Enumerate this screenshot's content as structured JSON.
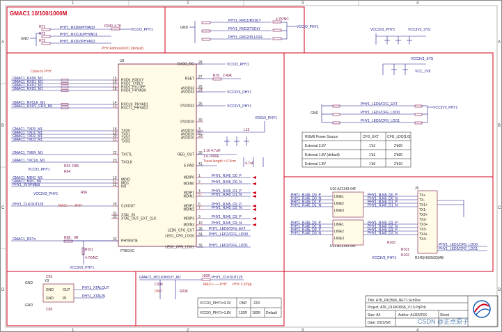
{
  "grid": {
    "columns": [
      "1",
      "2",
      "3",
      "4"
    ],
    "rows": [
      "A",
      "B",
      "C",
      "D"
    ]
  },
  "sections": {
    "title": "GMAC1 10/100/1000M",
    "phy_address": "PHY Address0x01 (default)",
    "close_to_phy": "Close to PHY",
    "mac_phy": "MAC<------PHY",
    "mac_phy2": "MAC<------PHY",
    "trace_length": "Trace length < 0.5cm",
    "dnp": "DNP",
    "vcc3v3_sys": "VCC3V3_SYS",
    "vcc1v8": "VCC_1V8"
  },
  "chip": {
    "ref": "U9",
    "part": "YT8531C",
    "left_pins": [
      {
        "name": "RXD0_RXDLY",
        "num": "15"
      },
      {
        "name": "RXD1_TXDLY",
        "num": "16"
      },
      {
        "name": "RXD2_PLLOFF",
        "num": "17"
      },
      {
        "name": "RXD3_PHYAD0",
        "num": "18"
      },
      {
        "name": "RXCLK_PHYAD1",
        "num": "14"
      },
      {
        "name": "RXCTL_PHYAD2",
        "num": "13"
      },
      {
        "name": "TXD0",
        "num": "18"
      },
      {
        "name": "TXD1",
        "num": "19"
      },
      {
        "name": "TXD2",
        "num": "20"
      },
      {
        "name": "TXD3",
        "num": "21"
      },
      {
        "name": "TXCTL",
        "num": "22"
      },
      {
        "name": "TXCLK",
        "num": "23"
      },
      {
        "name": "MDIO",
        "num": "10"
      },
      {
        "name": "MDC",
        "num": "11"
      },
      {
        "name": "INT",
        "num": "12"
      },
      {
        "name": "CLKOUT",
        "num": "29"
      },
      {
        "name": "XTAL_IN",
        "num": "31"
      },
      {
        "name": "XTAL_OUT_EXT_CLK",
        "num": "33"
      },
      {
        "name": "PHYRSTB",
        "num": "32"
      }
    ],
    "right_pins": [
      {
        "name": "DVDD_RG",
        "num": "28"
      },
      {
        "name": "RSET",
        "num": "27"
      },
      {
        "name": "AVDD33",
        "num": "26"
      },
      {
        "name": "AVDD33",
        "num": "24"
      },
      {
        "name": "DVDD33",
        "num": "25"
      },
      {
        "name": "DVDD10",
        "num": "30"
      },
      {
        "name": "AVDD10",
        "num": "3"
      },
      {
        "name": "AVDD10",
        "num": "8"
      },
      {
        "name": "AVDD10",
        "num": "23"
      },
      {
        "name": "REG_OUT",
        "num": "30"
      },
      {
        "name": "E-PAD",
        "num": "41"
      },
      {
        "name": "MDIP0",
        "num": "1"
      },
      {
        "name": "MDIN0",
        "num": "2"
      },
      {
        "name": "MDIP1",
        "num": "4"
      },
      {
        "name": "MDIN1",
        "num": "5"
      },
      {
        "name": "MDIP2",
        "num": "6"
      },
      {
        "name": "MDIN2",
        "num": "7"
      },
      {
        "name": "MDIP3",
        "num": "9"
      },
      {
        "name": "MDIN3",
        "num": "10"
      },
      {
        "name": "LED0_CFG_EXT",
        "num": "36"
      },
      {
        "name": "LED1_CFG_LDO0",
        "num": "34"
      },
      {
        "name": "LED2_CFG_LDO1",
        "num": "35"
      }
    ]
  },
  "left_nets": [
    "GMAC1_RXD0_M1",
    "GMAC1_RXD1_M1",
    "GMAC1_RXD2_M1",
    "GMAC1_RXD3_M1",
    "GMAC1_RXCLK_M1",
    "GMAC1_RXDV_CRS_M1",
    "GMAC1_TXD0_M1",
    "GMAC1_TXD1_M1",
    "GMAC1_TXD2_M1",
    "GMAC1_TXD3_M1",
    "GMAC1_TXEN_M1",
    "GMAC1_TXCLK_M1",
    "GMAC1_MDIO_M1",
    "GMAC1_MDC_M1",
    "PHY1_INT/PMEB",
    "PHY1_CLKOUT125",
    "GMAC1_RSTn"
  ],
  "top_left": {
    "labels": [
      "PHY1_RXD0/PHYAD0",
      "PHY1_RXCLK/PHYAD1",
      "PHY1_RXDV/PHYAD2"
    ],
    "res": [
      "R240",
      "R71",
      "R72",
      "R73"
    ],
    "val": "4.7K",
    "vcc": "VCCIO_PHY1",
    "gnd": "GND"
  },
  "top_mid": {
    "labels": [
      "PHY1_RXD1/RXDLY",
      "PHY1_RXD3/TXDLY",
      "PHY1_RXD2/PLLOFF"
    ],
    "vcc": "VCCIO_PHY1",
    "val": "4.7K/NC",
    "gnd": "GND"
  },
  "config_table": {
    "header": [
      "RGMII Power Source",
      "CFG_EXT",
      "CFG_LDO[1:0]"
    ],
    "rows": [
      [
        "External 3.3V",
        "1'b1",
        "2'b00"
      ],
      [
        "External 1.8V (default)",
        "1'b1",
        "2'b00"
      ],
      [
        "External 1.8V",
        "1'b0",
        "2'b10"
      ]
    ]
  },
  "led_cfg": {
    "labels": [
      "PHY1_LED0/CFG_EXT",
      "PHY1_LED1/CFG_LDO0",
      "PHY1_LED2/CFG_LDO1"
    ],
    "vcc": "VCC3V3_PHY1"
  },
  "power": {
    "vccio": "VCCIO_PHY1",
    "vcc33": "VCC3V3_PHY1",
    "vdd10": "VDD10_PHY1",
    "r76": "R76",
    "r76v": "2.49K",
    "l13": "L13",
    "l14": "1.16 4.7uH",
    "cap": "4.7uF",
    "c1": "1.6.1000E"
  },
  "rj45": {
    "transformer": "U10 AZ1143-04F",
    "transformer2": "U11 AZ1143-04F",
    "conn": "J5",
    "part": "RJ45(HX65/33)AB",
    "nets": [
      "PHY1_RJ45_D0_P",
      "PHY1_RJ45_D0_N",
      "PHY1_RJ45_D1_P",
      "PHY1_RJ45_D1_N",
      "PHY1_RJ45_D2_P",
      "PHY1_RJ45_D2_N",
      "PHY1_RJ45_D3_P",
      "PHY1_RJ45_D3_N"
    ],
    "tx_labels": [
      "TX+",
      "TX-",
      "TX1+",
      "TX1-",
      "TX2+",
      "TX2-",
      "TX3+",
      "TX3-",
      "TX4+",
      "TX4-"
    ],
    "line_labels": [
      "LINE1",
      "LINE2",
      "LINE3",
      "LINE4"
    ],
    "r100": "R100",
    "r101": "R101",
    "r102": "R102",
    "led_nets": [
      "PHY1_LED1/CFG_LDO0",
      "PHY1_LED2/CFG_LDO1"
    ]
  },
  "mdio": {
    "vcc": "VCCIO_PHY1",
    "res": [
      "R63",
      "R64",
      "R65",
      "R66"
    ],
    "vcc33": "VCC3V3_PHY1"
  },
  "rst": {
    "r98": "R98",
    "r98v": "0R",
    "r101": "R101",
    "r101v": "4.7K/NC",
    "vcc": "VCC3V3_PHY1"
  },
  "crystal": {
    "ref": "Y3",
    "labels": [
      "PHY1_XTALOUT",
      "PHY1_XTALIN"
    ],
    "pins": [
      "GND",
      "OUT",
      "GND",
      "IN"
    ],
    "caps": [
      "C63",
      "C65"
    ]
  },
  "clkout": {
    "net": "GMAC1_MCLKINOUT_M1",
    "r": "100R",
    "r2": "R236",
    "c": "C206",
    "label": "PHY1_CLKOUT125",
    "dnp": "DNP",
    "phy33": "PHY 3.3Vpp"
  },
  "vccio_table": {
    "rows": [
      [
        "VCCIO_PHY1=3.3V",
        "DNP",
        "22R"
      ],
      [
        "VCCIO_PHY1=1.8V",
        "120R",
        "100R",
        "Default"
      ]
    ]
  },
  "title_block": {
    "title": "Title:  ATK_RK3568_NET1.SchDoc",
    "project": "Project:  ATK_DLRK3568_V1.5.PrjPcb",
    "size": "Size:  A4",
    "date": "Date:  2023/5/8",
    "author": "Author:  ALIENTEK",
    "sheet": "Sheet",
    "watermark": "CSDN @正点原子"
  }
}
